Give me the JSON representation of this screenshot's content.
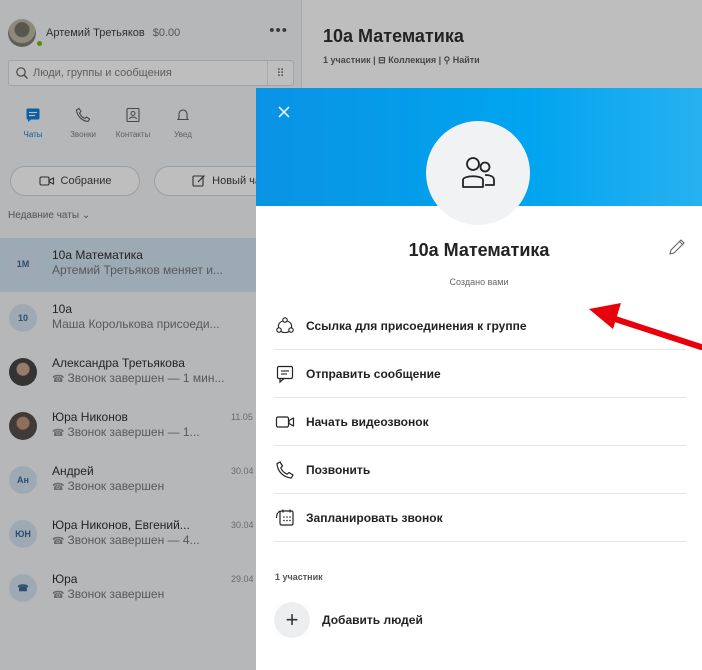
{
  "profile": {
    "name": "Артемий Третьяков",
    "balance": "$0.00",
    "more": "•••"
  },
  "search": {
    "placeholder": "Люди, группы и сообщения",
    "dialpad": "⠿"
  },
  "nav": [
    {
      "label": "Чаты",
      "icon": "chat-icon",
      "active": true
    },
    {
      "label": "Звонки",
      "icon": "phone-icon"
    },
    {
      "label": "Контакты",
      "icon": "contacts-icon"
    },
    {
      "label": "Увед",
      "icon": "bell-icon"
    }
  ],
  "actions": {
    "meet": "Собрание",
    "new_chat": "Новый чат"
  },
  "recent": {
    "label": "Недавние чаты"
  },
  "chats": [
    {
      "title": "10а Математика",
      "subtitle": "Артемий Третьяков меняет и...",
      "date": "",
      "initials": "1М",
      "selected": true
    },
    {
      "title": "10а",
      "subtitle": "Маша Королькова присоеди...",
      "date": "",
      "initials": "10"
    },
    {
      "title": "Александра Третьякова",
      "subtitle": "Звонок завершен — 1 мин...",
      "date": "",
      "initials": ""
    },
    {
      "title": "Юра Никонов",
      "subtitle": "Звонок завершен — 1...",
      "date": "11.05",
      "initials": ""
    },
    {
      "title": "Андрей",
      "subtitle": "Звонок завершен",
      "date": "30.04",
      "initials": "Ан"
    },
    {
      "title": "Юра Никонов, Евгений...",
      "subtitle": "Звонок завершен — 4...",
      "date": "30.04",
      "initials": "ЮН"
    },
    {
      "title": "Юра",
      "subtitle": "Звонок завершен",
      "date": "29.04",
      "initials": "☎"
    }
  ],
  "header": {
    "title": "10а Математика",
    "meta": "1 участник | ⊟ Коллекция | ⚲ Найти"
  },
  "modal": {
    "group_name": "10а Математика",
    "created_by": "Создано вами",
    "menu": [
      {
        "label": "Ссылка для присоединения к группе",
        "icon": "group-link-icon"
      },
      {
        "label": "Отправить сообщение",
        "icon": "message-icon"
      },
      {
        "label": "Начать видеозвонок",
        "icon": "video-icon"
      },
      {
        "label": "Позвонить",
        "icon": "phone-icon"
      },
      {
        "label": "Запланировать звонок",
        "icon": "calendar-icon"
      }
    ],
    "members_label": "1 участник",
    "add_people": "Добавить людей"
  },
  "colors": {
    "accent": "#0078d4",
    "banner": "#00a4ef",
    "arrow": "#e8000b"
  }
}
